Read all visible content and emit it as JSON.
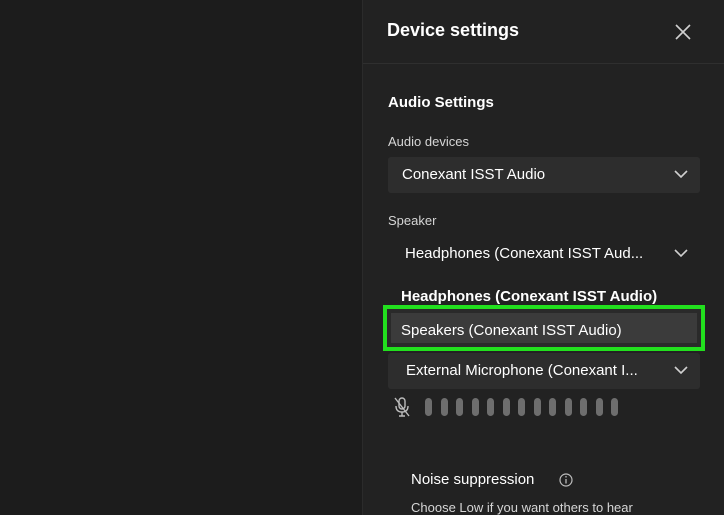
{
  "panel": {
    "title": "Device settings",
    "close_icon": "close-icon"
  },
  "audio": {
    "section_title": "Audio Settings",
    "devices_label": "Audio devices",
    "devices_value": "Conexant ISST Audio",
    "speaker_label": "Speaker",
    "speaker_value": "Headphones (Conexant ISST Aud...",
    "speaker_options": [
      "Headphones (Conexant ISST Audio)",
      "Speakers (Conexant ISST Audio)"
    ],
    "microphone_value": "External Microphone (Conexant I...",
    "mic_icon": "mic-off-icon",
    "level_bars": 13
  },
  "noise": {
    "label": "Noise suppression",
    "info_icon": "info-icon",
    "description": "Choose Low if you want others to hear"
  },
  "colors": {
    "highlight": "#22e01e",
    "panel_bg": "#222222",
    "page_bg": "#1c1c1c"
  }
}
